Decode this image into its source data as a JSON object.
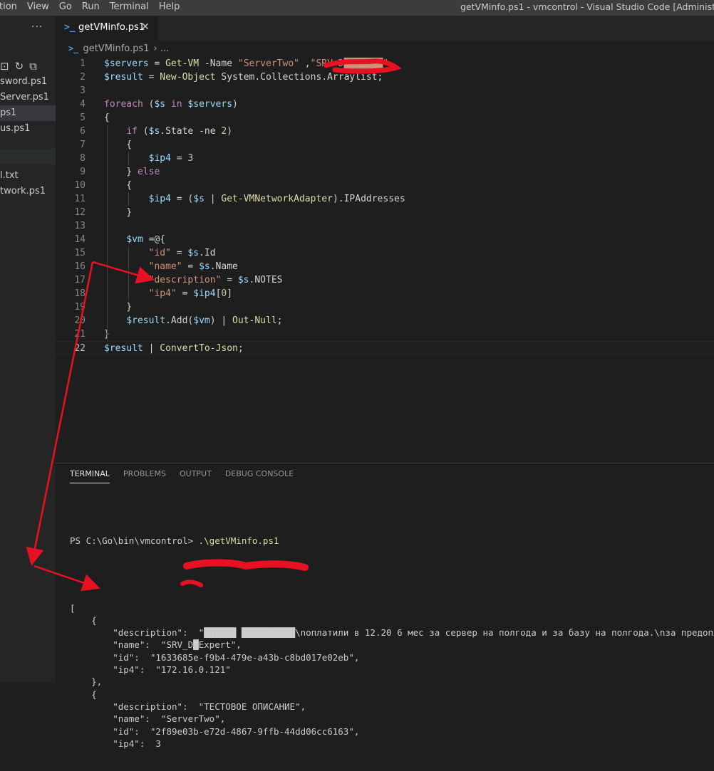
{
  "window": {
    "title": "getVMinfo.ps1 - vmcontrol - Visual Studio Code [Administrator]",
    "menu": [
      "tion",
      "View",
      "Go",
      "Run",
      "Terminal",
      "Help"
    ]
  },
  "sidebar": {
    "more_icon": "ellipsis-icon",
    "toolbar_icons": [
      "new-folder-icon",
      "refresh-icon",
      "collapse-all-icon"
    ],
    "files": [
      "sword.ps1",
      "Server.ps1",
      "ps1",
      "us.ps1",
      "",
      "l.txt",
      "twork.ps1"
    ],
    "active_index": 2
  },
  "tab": {
    "label": "getVMinfo.ps1",
    "icon": "powershell-icon",
    "close_icon": "close-icon"
  },
  "breadcrumb": {
    "file": "getVMinfo.ps1",
    "separator": "›",
    "trail": "..."
  },
  "editor": {
    "lines": [
      {
        "n": "1",
        "tokens": [
          [
            "var",
            "$servers"
          ],
          [
            "op",
            " = "
          ],
          [
            "cmd",
            "Get-VM"
          ],
          [
            "op",
            " -Name "
          ],
          [
            "str",
            "\"ServerTwo\""
          ],
          [
            "op",
            " ,"
          ],
          [
            "str",
            "\"SRV_D███████\""
          ]
        ]
      },
      {
        "n": "2",
        "tokens": [
          [
            "var",
            "$result"
          ],
          [
            "op",
            " = "
          ],
          [
            "cmd",
            "New-Object"
          ],
          [
            "op",
            " System.Collections.Arraylist;"
          ]
        ]
      },
      {
        "n": "3",
        "tokens": []
      },
      {
        "n": "4",
        "tokens": [
          [
            "kw",
            "foreach"
          ],
          [
            "op",
            " ("
          ],
          [
            "var",
            "$s"
          ],
          [
            "kw",
            " in "
          ],
          [
            "var",
            "$servers"
          ],
          [
            "op",
            ")"
          ]
        ]
      },
      {
        "n": "5",
        "tokens": [
          [
            "op",
            "{"
          ]
        ]
      },
      {
        "n": "6",
        "tokens": [
          [
            "op",
            "    "
          ],
          [
            "kw",
            "if"
          ],
          [
            "op",
            " ("
          ],
          [
            "var",
            "$s"
          ],
          [
            "op",
            ".State -ne "
          ],
          [
            "num",
            "2"
          ],
          [
            "op",
            ")"
          ]
        ]
      },
      {
        "n": "7",
        "tokens": [
          [
            "op",
            "    {"
          ]
        ]
      },
      {
        "n": "8",
        "tokens": [
          [
            "op",
            "        "
          ],
          [
            "var",
            "$ip4"
          ],
          [
            "op",
            " = "
          ],
          [
            "num",
            "3"
          ]
        ]
      },
      {
        "n": "9",
        "tokens": [
          [
            "op",
            "    } "
          ],
          [
            "kw",
            "else"
          ]
        ]
      },
      {
        "n": "10",
        "tokens": [
          [
            "op",
            "    {"
          ]
        ]
      },
      {
        "n": "11",
        "tokens": [
          [
            "op",
            "        "
          ],
          [
            "var",
            "$ip4"
          ],
          [
            "op",
            " = ("
          ],
          [
            "var",
            "$s"
          ],
          [
            "op",
            " | "
          ],
          [
            "cmd",
            "Get-VMNetworkAdapter"
          ],
          [
            "op",
            ").IPAddresses"
          ]
        ]
      },
      {
        "n": "12",
        "tokens": [
          [
            "op",
            "    }"
          ]
        ]
      },
      {
        "n": "13",
        "tokens": []
      },
      {
        "n": "14",
        "tokens": [
          [
            "op",
            "    "
          ],
          [
            "var",
            "$vm"
          ],
          [
            "op",
            " =@{"
          ]
        ]
      },
      {
        "n": "15",
        "tokens": [
          [
            "op",
            "        "
          ],
          [
            "str",
            "\"id\""
          ],
          [
            "op",
            " = "
          ],
          [
            "var",
            "$s"
          ],
          [
            "op",
            ".Id"
          ]
        ]
      },
      {
        "n": "16",
        "tokens": [
          [
            "op",
            "        "
          ],
          [
            "str",
            "\"name\""
          ],
          [
            "op",
            " = "
          ],
          [
            "var",
            "$s"
          ],
          [
            "op",
            ".Name"
          ]
        ]
      },
      {
        "n": "17",
        "tokens": [
          [
            "op",
            "        "
          ],
          [
            "str",
            "\"description\""
          ],
          [
            "op",
            " = "
          ],
          [
            "var",
            "$s"
          ],
          [
            "op",
            ".NOTES"
          ]
        ]
      },
      {
        "n": "18",
        "tokens": [
          [
            "op",
            "        "
          ],
          [
            "str",
            "\"ip4\""
          ],
          [
            "op",
            " = "
          ],
          [
            "var",
            "$ip4"
          ],
          [
            "op",
            "["
          ],
          [
            "num",
            "0"
          ],
          [
            "op",
            "]"
          ]
        ]
      },
      {
        "n": "19",
        "tokens": [
          [
            "op",
            "    }"
          ]
        ]
      },
      {
        "n": "20",
        "tokens": [
          [
            "op",
            "    "
          ],
          [
            "var",
            "$result"
          ],
          [
            "op",
            ".Add("
          ],
          [
            "var",
            "$vm"
          ],
          [
            "op",
            ") | "
          ],
          [
            "cmd",
            "Out-Null"
          ],
          [
            "op",
            ";"
          ]
        ]
      },
      {
        "n": "21",
        "tokens": [
          [
            "op",
            "}"
          ]
        ]
      },
      {
        "n": "22",
        "tokens": [
          [
            "var",
            "$result"
          ],
          [
            "op",
            " | "
          ],
          [
            "cmd",
            "ConvertTo-Json"
          ],
          [
            "op",
            ";"
          ]
        ]
      }
    ],
    "current_line": "22"
  },
  "panel": {
    "tabs": [
      "TERMINAL",
      "PROBLEMS",
      "OUTPUT",
      "DEBUG CONSOLE"
    ],
    "active_tab": 0
  },
  "terminal": {
    "prompt": "PS C:\\Go\\bin\\vmcontrol> ",
    "command": ".\\getVMinfo.ps1",
    "output": [
      "[",
      "    {",
      "        \"description\":  \"██████ ██████████\\nоплатили в 12.20 6 мес за сервер на полгода и за базу на полгода.\\nза предоплату",
      "        \"name\":  \"SRV_D█Expert\",",
      "        \"id\":  \"1633685e-f9b4-479e-a43b-c8bd017e02eb\",",
      "        \"ip4\":  \"172.16.0.121\"",
      "    },",
      "    {",
      "        \"description\":  \"ТЕСТОВОЕ ОПИСАНИЕ\",",
      "        \"name\":  \"ServerTwo\",",
      "        \"id\":  \"2f89e03b-e72d-4867-9ffb-44dd06cc6163\",",
      "        \"ip4\":  3"
    ]
  },
  "colors": {
    "redaction": "#e81123",
    "annotation_arrow": "#e81123"
  }
}
